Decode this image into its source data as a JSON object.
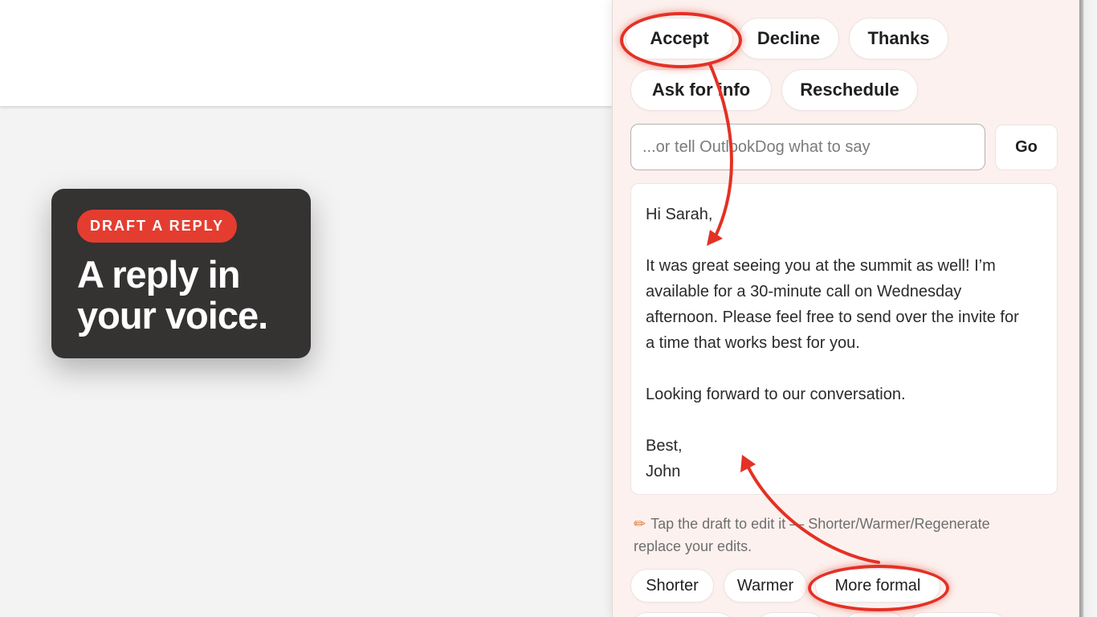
{
  "callout": {
    "badge": "DRAFT A REPLY",
    "headline_line1": "A reply in",
    "headline_line2": "your voice."
  },
  "quick_replies": [
    "Accept",
    "Decline",
    "Thanks",
    "Ask for info",
    "Reschedule"
  ],
  "prompt": {
    "placeholder": "...or tell OutlookDog what to say",
    "go_label": "Go"
  },
  "draft": {
    "greeting": "Hi Sarah,",
    "body_lines": [
      "It was great seeing you at the summit as well! I’m",
      "available for a 30-minute call on Wednesday",
      "afternoon. Please feel free to send over the invite for",
      "a time that works best for you."
    ],
    "closing_line": "Looking forward to our conversation.",
    "signoff": "Best,",
    "name": "John"
  },
  "tip": {
    "icon": "pencil-icon",
    "line1": "Tap the draft to edit it — Shorter/Warmer/Regenerate",
    "line2": "replace your edits."
  },
  "tone_buttons": [
    "Shorter",
    "Warmer",
    "More formal"
  ],
  "colors": {
    "accent_red": "#e33125",
    "pane_background": "#fcf1ee",
    "callout_background": "#353232"
  }
}
